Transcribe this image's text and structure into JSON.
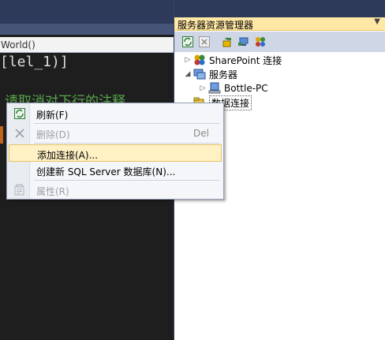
{
  "editor": {
    "method_combo": "World()",
    "code_line": "[lel_1)]",
    "comment": "请取消对下行的注释。"
  },
  "explorer": {
    "title": "服务器资源管理器",
    "tree": {
      "sharepoint": "SharePoint 连接",
      "servers": "服务器",
      "bottle_pc": "Bottle-PC",
      "data_connections": "数据连接"
    }
  },
  "context_menu": {
    "refresh": "刷新(F)",
    "delete": "删除(D)",
    "delete_shortcut": "Del",
    "add_connection": "添加连接(A)...",
    "create_db": "创建新 SQL Server 数据库(N)...",
    "properties": "属性(R)"
  },
  "colors": {
    "highlight": "#fff1c4",
    "title_bar": "#ffe8a6",
    "comment_green": "#57a64a"
  }
}
